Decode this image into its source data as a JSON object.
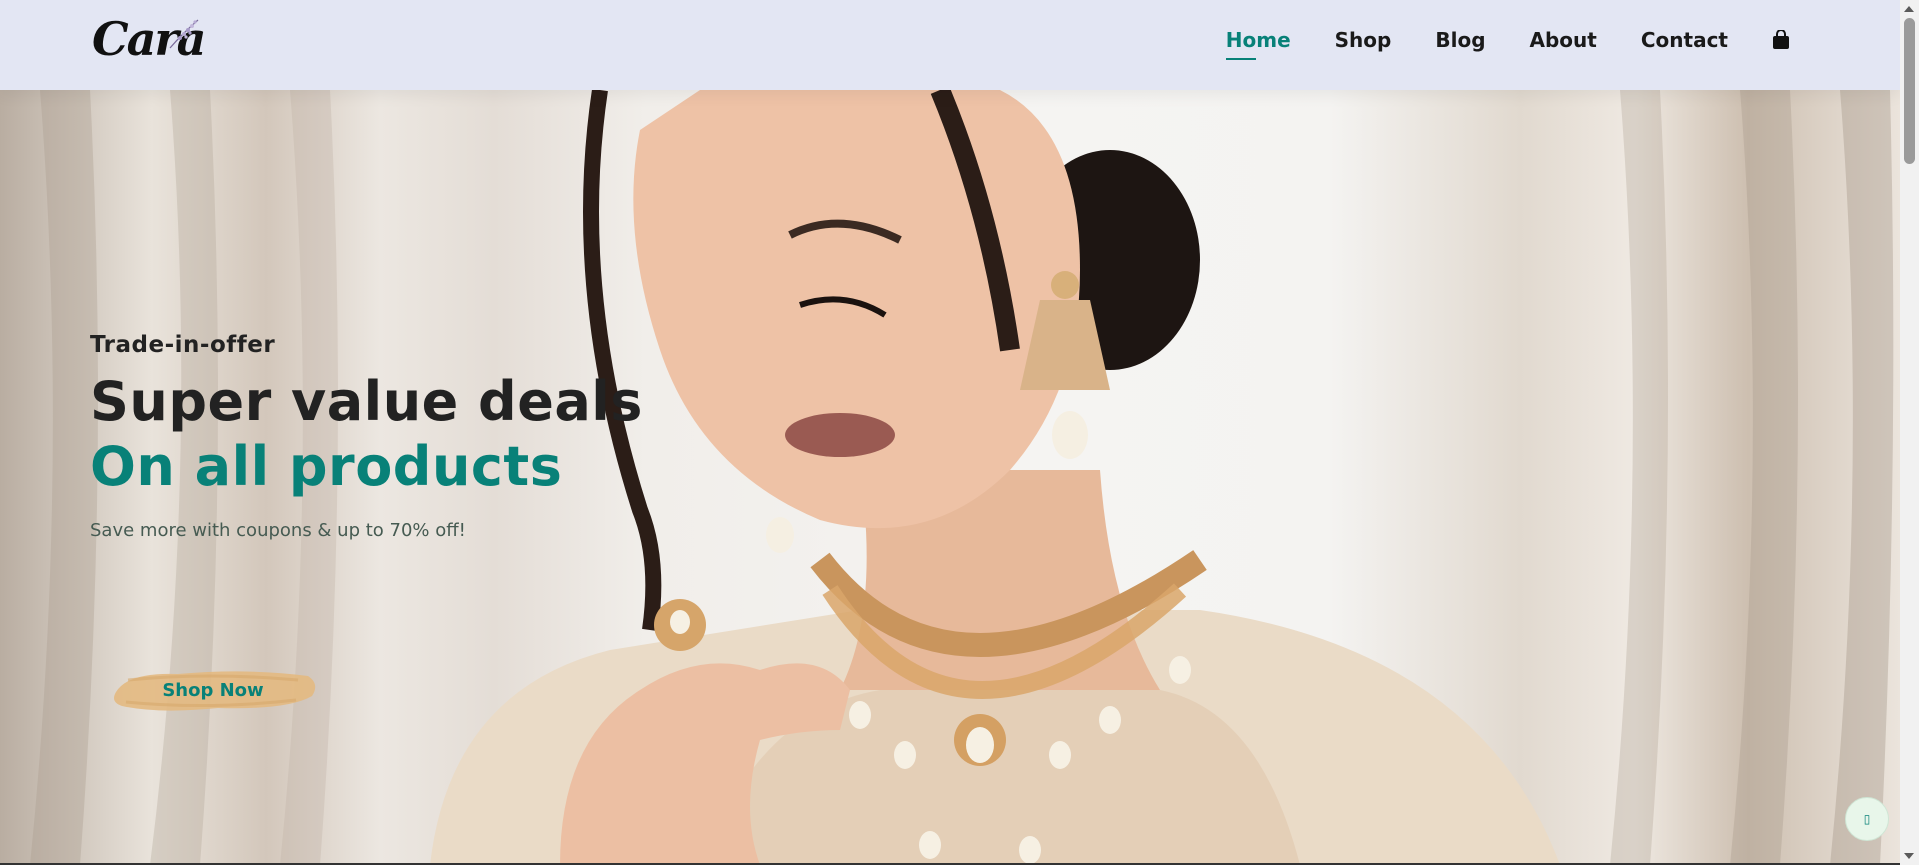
{
  "brand": {
    "logo_text": "Cara"
  },
  "nav": {
    "items": [
      {
        "label": "Home",
        "active": true
      },
      {
        "label": "Shop",
        "active": false
      },
      {
        "label": "Blog",
        "active": false
      },
      {
        "label": "About",
        "active": false
      },
      {
        "label": "Contact",
        "active": false
      }
    ],
    "cart_icon": "shopping-bag-icon"
  },
  "hero": {
    "kicker": "Trade-in-offer",
    "headline": "Super value deals",
    "headline_accent": "On all products",
    "subtext": "Save more with coupons & up to 70% off!",
    "cta_label": "Shop Now",
    "image": "model-wearing-gold-jewelry"
  },
  "floating_button": {
    "icon": "chat-icon",
    "glyph": "▯"
  },
  "colors": {
    "accent": "#088178",
    "header_bg": "#e3e6f3",
    "text_dark": "#222222",
    "cta_brush": "#e3b981"
  }
}
